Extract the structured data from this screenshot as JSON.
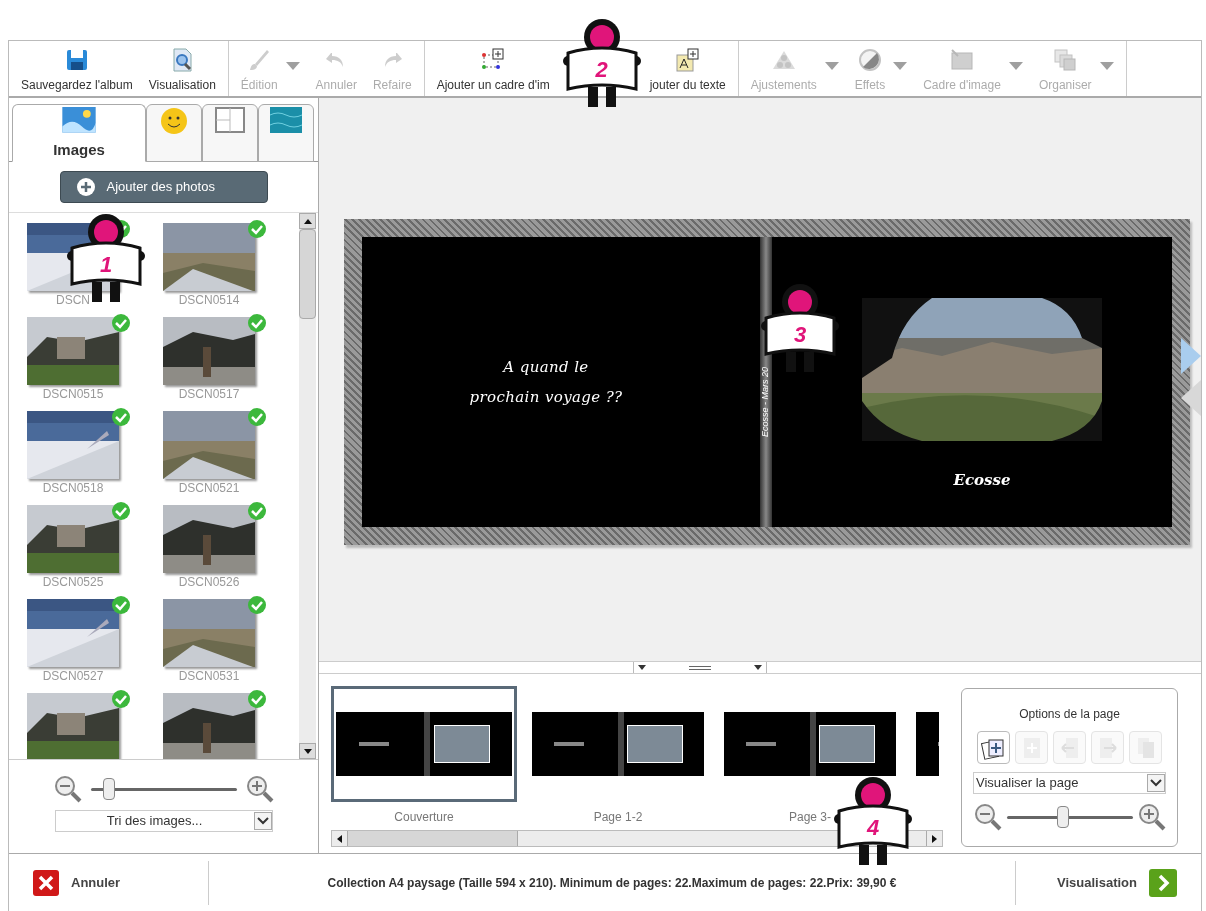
{
  "toolbar": {
    "groups": [
      [
        {
          "kind": "save",
          "label": "Sauvegardez l'album",
          "disabled": false,
          "dropdown": false
        },
        {
          "kind": "preview",
          "label": "Visualisation",
          "disabled": false,
          "dropdown": false
        }
      ],
      [
        {
          "kind": "edit",
          "label": "Édition",
          "disabled": true,
          "dropdown": true
        },
        {
          "kind": "undo",
          "label": "Annuler",
          "disabled": true,
          "dropdown": false
        },
        {
          "kind": "redo",
          "label": "Refaire",
          "disabled": true,
          "dropdown": false
        }
      ],
      [
        {
          "kind": "frame",
          "label": "Ajouter un cadre d'im",
          "disabled": false,
          "dropdown": false
        },
        {
          "kind": "text",
          "label": "jouter du texte",
          "disabled": false,
          "dropdown": false
        }
      ],
      [
        {
          "kind": "adjust",
          "label": "Ajustements",
          "disabled": true,
          "dropdown": true
        },
        {
          "kind": "effects",
          "label": "Effets",
          "disabled": true,
          "dropdown": true
        },
        {
          "kind": "imageframe",
          "label": "Cadre d'image",
          "disabled": true,
          "dropdown": true
        },
        {
          "kind": "arrange",
          "label": "Organiser",
          "disabled": true,
          "dropdown": true
        }
      ]
    ]
  },
  "left_panel": {
    "tabs": [
      {
        "kind": "images",
        "label": "Images",
        "selected": true
      },
      {
        "kind": "stickers",
        "selected": false
      },
      {
        "kind": "layouts",
        "selected": false
      },
      {
        "kind": "backgrounds",
        "selected": false
      }
    ],
    "add_button": "Ajouter des photos",
    "photos": [
      {
        "name": "DSCN",
        "used": true
      },
      {
        "name": "DSCN0514",
        "used": true
      },
      {
        "name": "DSCN0515",
        "used": true
      },
      {
        "name": "DSCN0517",
        "used": true
      },
      {
        "name": "DSCN0518",
        "used": true
      },
      {
        "name": "DSCN0521",
        "used": true
      },
      {
        "name": "DSCN0525",
        "used": true
      },
      {
        "name": "DSCN0526",
        "used": true
      },
      {
        "name": "DSCN0527",
        "used": true
      },
      {
        "name": "DSCN0531",
        "used": true
      },
      {
        "used": true
      },
      {
        "used": true
      }
    ],
    "zoom": {
      "level": 0.13
    },
    "sort": "Tri des images..."
  },
  "canvas": {
    "left_text": [
      "A quand le",
      "prochain voyage ??"
    ],
    "spine_text": "Ecosse - Mars 20",
    "caption": "Ecosse"
  },
  "filmstrip": {
    "pages": [
      {
        "label": "Couverture",
        "selected": true
      },
      {
        "label": "Page 1-2",
        "selected": false
      },
      {
        "label": "Page 3-",
        "selected": false
      },
      {
        "selected": false
      }
    ]
  },
  "page_options": {
    "title": "Options de la page",
    "buttons": [
      {
        "kind": "add-photos",
        "disabled": false
      },
      {
        "kind": "add-page",
        "disabled": true
      },
      {
        "kind": "move-left",
        "disabled": true
      },
      {
        "kind": "move-right",
        "disabled": true
      },
      {
        "kind": "copy",
        "disabled": true
      }
    ],
    "view": "Visualiser la page",
    "zoom": {
      "level": 0.45
    }
  },
  "status_bar": {
    "cancel": "Annuler",
    "info": "Collection A4 paysage (Taille 594 x 210). Minimum de pages: 22.Maximum de pages: 22.Prix: 39,90 €",
    "preview": "Visualisation"
  },
  "callouts": [
    {
      "number": "1"
    },
    {
      "number": "2"
    },
    {
      "number": "3"
    },
    {
      "number": "4"
    }
  ]
}
